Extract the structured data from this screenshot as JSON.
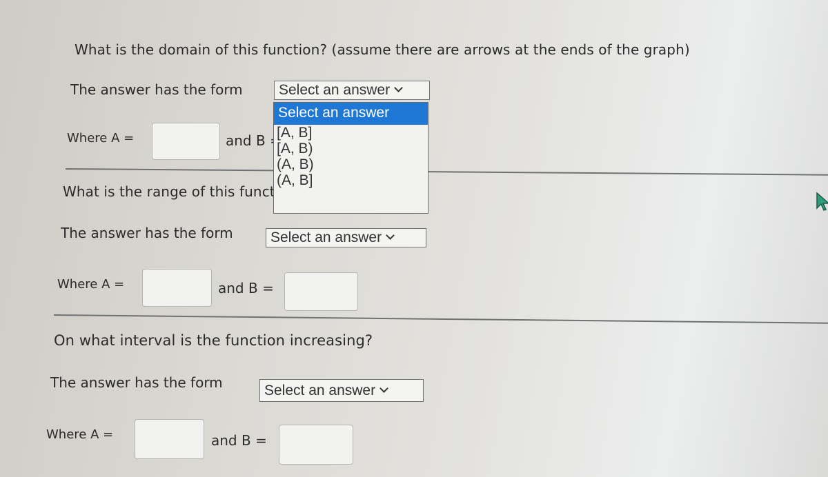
{
  "questions": [
    {
      "prompt": "What is the domain of this function? (assume there are arrows at the ends of the graph)",
      "form_label": "The answer has the form",
      "select": {
        "value": "Select an answer",
        "expanded": true
      },
      "where_a_label": "Where A =",
      "a_value": "",
      "and_b_label": "and B =",
      "b_value": ""
    },
    {
      "prompt": "What is the range of this function?",
      "form_label": "The answer has the form",
      "select": {
        "value": "Select an answer",
        "expanded": false
      },
      "where_a_label": "Where A =",
      "a_value": "",
      "and_b_label": "and B =",
      "b_value": ""
    },
    {
      "prompt": "On what interval is the function increasing?",
      "form_label": "The answer has the form",
      "select": {
        "value": "Select an answer",
        "expanded": false
      },
      "where_a_label": "Where A =",
      "a_value": "",
      "and_b_label": "and B =",
      "b_value": ""
    }
  ],
  "dropdown_options": [
    "Select an answer",
    "[A, B]",
    "[A, B)",
    "(A, B)",
    "(A, B]"
  ],
  "dropdown_highlighted": "Select an answer",
  "colors": {
    "highlight": "#1f77d6"
  },
  "cursor_icon": "mouse-pointer-icon"
}
